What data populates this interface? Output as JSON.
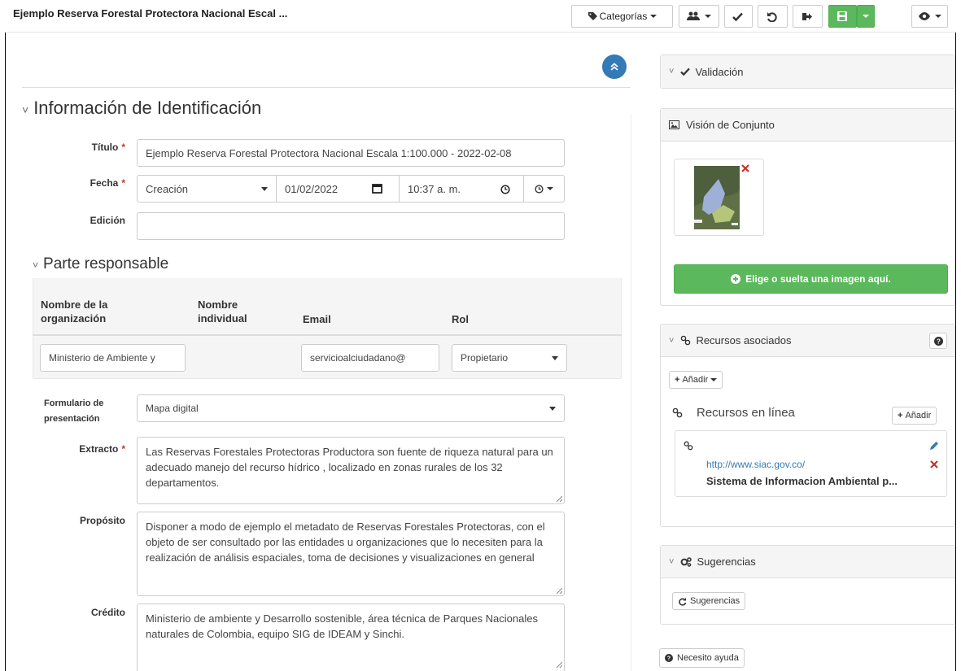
{
  "header": {
    "title": "Ejemplo Reserva Forestal Protectora Nacional Escal ...",
    "categories_label": "Categorías"
  },
  "section": {
    "title": "Información de Identificación"
  },
  "form": {
    "titulo_label": "Título",
    "titulo_value": "Ejemplo Reserva Forestal Protectora Nacional Escala 1:100.000 - 2022-02-08",
    "fecha_label": "Fecha",
    "fecha_type": "Creación",
    "fecha_date": "01/02/2022",
    "fecha_time": "10:37 a. m.",
    "edicion_label": "Edición",
    "edicion_value": "",
    "formulario_label_1": "Formulario de",
    "formulario_label_2": "presentación",
    "formulario_value": "Mapa digital",
    "extracto_label": "Extracto",
    "extracto_value": "Las Reservas Forestales Protectoras Productora son fuente de riqueza natural para un adecuado manejo del recurso hídrico , localizado en zonas rurales de los 32 departamentos.",
    "proposito_label": "Propósito",
    "proposito_value": "Disponer a modo de ejemplo el metadato de Reservas Forestales Protectoras, con el objeto de ser consultado por las entidades u organizaciones que lo necesiten para la realización de análisis espaciales, toma de decisiones y visualizaciones en general",
    "credito_label": "Crédito",
    "credito_value": "Ministerio de ambiente y Desarrollo sostenible, área técnica de Parques Nacionales naturales de Colombia, equipo SIG de IDEAM y Sinchi."
  },
  "party": {
    "title": "Parte responsable",
    "col_org_1": "Nombre de la",
    "col_org_2": "organización",
    "col_ind_1": "Nombre",
    "col_ind_2": "individual",
    "col_email": "Email",
    "col_rol": "Rol",
    "org_value": "Ministerio de Ambiente y",
    "email_value": "servicioalciudadano@",
    "rol_value": "Propietario"
  },
  "sidebar": {
    "validacion": "Validación",
    "vision": "Visión de Conjunto",
    "drop_image": "Elige o suelta una imagen aquí.",
    "recursos": "Recursos asociados",
    "anadir": "Añadir",
    "recursos_linea": "Recursos en línea",
    "anadir2": "Añadir",
    "resource_url": "http://www.siac.gov.co/",
    "resource_name": "Sistema de Informacion Ambiental p...",
    "sugerencias": "Sugerencias",
    "sugerencias_btn": "Sugerencias",
    "ayuda": "Necesito ayuda"
  }
}
